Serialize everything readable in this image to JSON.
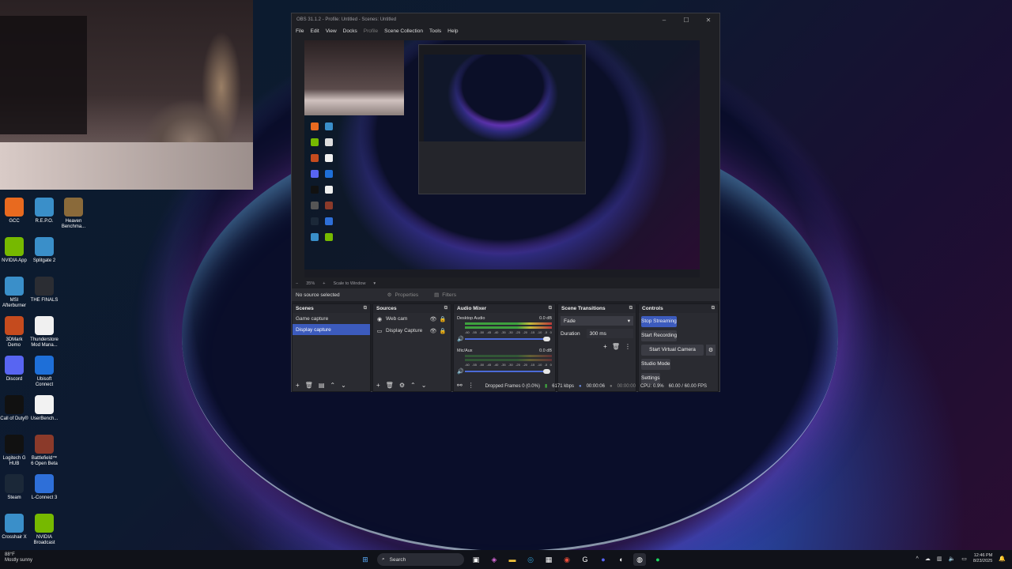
{
  "desktop": {
    "icons": [
      {
        "label": "GCC",
        "icon": "gcc-icon",
        "color": "#e86a1f"
      },
      {
        "label": "R.E.P.O.",
        "icon": "globe-icon",
        "color": "#3a8fc9"
      },
      {
        "label": "Heaven Benchma...",
        "icon": "heaven-icon",
        "color": "#8a6a3a"
      },
      {
        "label": "NVIDIA App",
        "icon": "nvidia-icon",
        "color": "#76b900"
      },
      {
        "label": "Splitgate 2",
        "icon": "globe-icon",
        "color": "#3a8fc9"
      },
      {
        "label": "MSI Afterburner",
        "icon": "globe-icon",
        "color": "#3a8fc9"
      },
      {
        "label": "THE FINALS",
        "icon": "finals-icon",
        "color": "#2b2d33"
      },
      {
        "label": "3DMark Demo",
        "icon": "3dmark-icon",
        "color": "#c54b1e"
      },
      {
        "label": "Thunderstore Mod Mana...",
        "icon": "file-icon",
        "color": "#f0f0f0"
      },
      {
        "label": "Discord",
        "icon": "discord-icon",
        "color": "#5865f2"
      },
      {
        "label": "Ubisoft Connect",
        "icon": "ubisoft-icon",
        "color": "#1e6fd8"
      },
      {
        "label": "Call of Duty®",
        "icon": "cod-icon",
        "color": "#111111"
      },
      {
        "label": "UserBench...",
        "icon": "gauge-icon",
        "color": "#f2f2f2"
      },
      {
        "label": "Logitech G HUB",
        "icon": "logitech-icon",
        "color": "#111111"
      },
      {
        "label": "Battlefield™ 6 Open Beta",
        "icon": "battlefield-icon",
        "color": "#8b3a2a"
      },
      {
        "label": "Steam",
        "icon": "steam-icon",
        "color": "#1b2838"
      },
      {
        "label": "L-Connect 3",
        "icon": "lconnect-icon",
        "color": "#2e6fd8"
      },
      {
        "label": "Crosshair X",
        "icon": "globe-icon",
        "color": "#3a8fc9"
      },
      {
        "label": "NVIDIA Broadcast",
        "icon": "nvidia-broadcast-icon",
        "color": "#76b900"
      }
    ]
  },
  "obs": {
    "title": "OBS 31.1.2 - Profile: Untitled - Scenes: Untitled",
    "menu": [
      "File",
      "Edit",
      "View",
      "Docks",
      "Profile",
      "Scene Collection",
      "Tools",
      "Help"
    ],
    "zoom": "35%",
    "scale_mode": "Scale to Window",
    "context": {
      "no_source": "No source selected",
      "properties": "Properties",
      "filters": "Filters"
    },
    "scenes": {
      "title": "Scenes",
      "items": [
        "Game capture",
        "Display capture"
      ],
      "selected_index": 1
    },
    "sources": {
      "title": "Sources",
      "items": [
        {
          "label": "Web cam",
          "icon": "camera-icon"
        },
        {
          "label": "Display Capture",
          "icon": "monitor-icon"
        }
      ]
    },
    "mixer": {
      "title": "Audio Mixer",
      "channels": [
        {
          "name": "Desktop Audio",
          "db": "0.0 dB"
        },
        {
          "name": "Mic/Aux",
          "db": "0.0 dB"
        }
      ],
      "scale_labels": [
        "-60",
        "-55",
        "-50",
        "-45",
        "-40",
        "-35",
        "-30",
        "-25",
        "-20",
        "-15",
        "-10",
        "-5",
        "0"
      ]
    },
    "transitions": {
      "title": "Scene Transitions",
      "selected": "Fade",
      "duration_label": "Duration",
      "duration_value": "300 ms"
    },
    "controls": {
      "title": "Controls",
      "stop_streaming": "Stop Streaming",
      "start_recording": "Start Recording",
      "start_virtual_camera": "Start Virtual Camera",
      "studio_mode": "Studio Mode",
      "settings": "Settings"
    },
    "status": {
      "dropped_frames": "Dropped Frames 0 (0.0%)",
      "bitrate": "6171 kbps",
      "stream_time": "00:00:06",
      "rec_time": "00:00:00",
      "cpu": "CPU: 0.9%",
      "fps": "60.00 / 60.00 FPS"
    }
  },
  "taskbar": {
    "temperature": "88°F",
    "weather": "Mostly sunny",
    "search_placeholder": "Search",
    "time": "12:46 PM",
    "date": "8/23/2025"
  }
}
